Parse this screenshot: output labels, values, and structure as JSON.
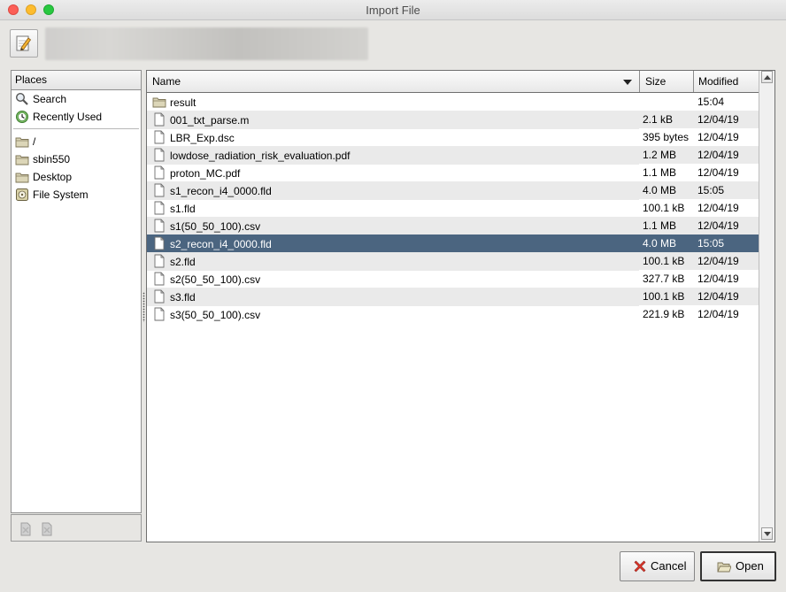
{
  "window": {
    "title": "Import File"
  },
  "places": {
    "header": "Places",
    "items": [
      {
        "label": "Search",
        "icon": "search-icon"
      },
      {
        "label": "Recently Used",
        "icon": "recent-icon"
      },
      {
        "label": "/",
        "icon": "folder-icon"
      },
      {
        "label": "sbin550",
        "icon": "folder-icon"
      },
      {
        "label": "Desktop",
        "icon": "folder-icon"
      },
      {
        "label": "File System",
        "icon": "drive-icon"
      }
    ]
  },
  "files": {
    "columns": {
      "name": "Name",
      "size": "Size",
      "modified": "Modified"
    },
    "rows": [
      {
        "name": "result",
        "size": "",
        "modified": "15:04",
        "type": "folder"
      },
      {
        "name": "001_txt_parse.m",
        "size": "2.1 kB",
        "modified": "12/04/19",
        "type": "file"
      },
      {
        "name": "LBR_Exp.dsc",
        "size": "395 bytes",
        "modified": "12/04/19",
        "type": "file"
      },
      {
        "name": "lowdose_radiation_risk_evaluation.pdf",
        "size": "1.2 MB",
        "modified": "12/04/19",
        "type": "file"
      },
      {
        "name": "proton_MC.pdf",
        "size": "1.1 MB",
        "modified": "12/04/19",
        "type": "file"
      },
      {
        "name": "s1_recon_i4_0000.fld",
        "size": "4.0 MB",
        "modified": "15:05",
        "type": "file"
      },
      {
        "name": "s1.fld",
        "size": "100.1 kB",
        "modified": "12/04/19",
        "type": "file"
      },
      {
        "name": "s1(50_50_100).csv",
        "size": "1.1 MB",
        "modified": "12/04/19",
        "type": "file"
      },
      {
        "name": "s2_recon_i4_0000.fld",
        "size": "4.0 MB",
        "modified": "15:05",
        "type": "file",
        "selected": true
      },
      {
        "name": "s2.fld",
        "size": "100.1 kB",
        "modified": "12/04/19",
        "type": "file"
      },
      {
        "name": "s2(50_50_100).csv",
        "size": "327.7 kB",
        "modified": "12/04/19",
        "type": "file"
      },
      {
        "name": "s3.fld",
        "size": "100.1 kB",
        "modified": "12/04/19",
        "type": "file"
      },
      {
        "name": "s3(50_50_100).csv",
        "size": "221.9 kB",
        "modified": "12/04/19",
        "type": "file"
      }
    ]
  },
  "buttons": {
    "cancel": "Cancel",
    "open": "Open"
  },
  "colors": {
    "selection": "#4b6580",
    "alt_row": "#eaeaea",
    "cancel_icon": "#e03a2f",
    "folder": "#d9d3b4"
  }
}
